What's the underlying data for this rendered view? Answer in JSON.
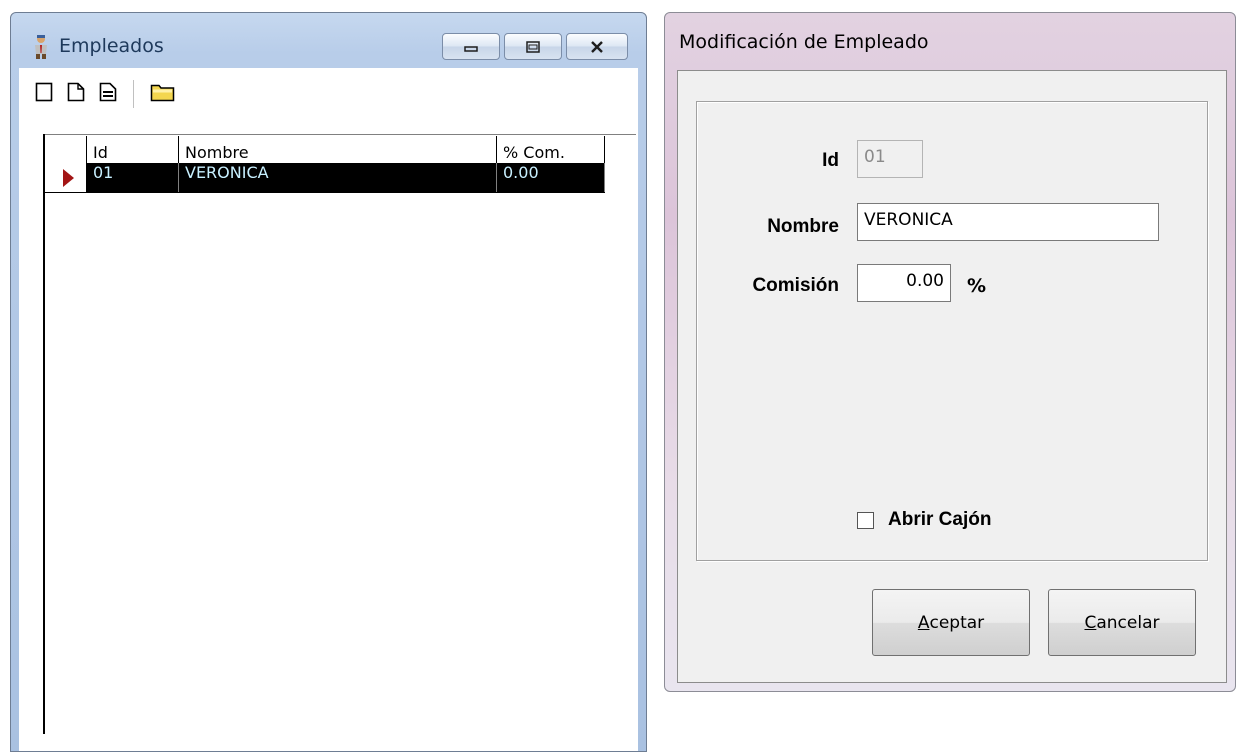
{
  "empleados_window": {
    "title": "Empleados",
    "toolbar": [
      {
        "name": "new-record-icon"
      },
      {
        "name": "new-document-icon"
      },
      {
        "name": "edit-record-icon"
      },
      {
        "name": "open-folder-icon"
      }
    ],
    "grid": {
      "columns": [
        "Id",
        "Nombre",
        "% Com."
      ],
      "rows": [
        {
          "id": "01",
          "nombre": "VERONICA",
          "com": "0.00",
          "selected": true
        }
      ]
    }
  },
  "modificacion_dialog": {
    "title": "Modificación de Empleado",
    "fields": {
      "id_label": "Id",
      "id_value": "01",
      "nombre_label": "Nombre",
      "nombre_value": "VERONICA",
      "comision_label": "Comisión",
      "comision_value": "0.00",
      "comision_unit": "%"
    },
    "abrir_cajon": {
      "label": "Abrir Cajón",
      "checked": false
    },
    "buttons": {
      "aceptar_mnemonic": "A",
      "aceptar_rest": "ceptar",
      "cancelar_mnemonic": "C",
      "cancelar_rest": "ancelar"
    }
  },
  "colors": {
    "grid_selected_bg": "#000000",
    "grid_selected_text": "#c8f0ff",
    "row_indicator": "#a31515",
    "window_frame_blue": "#b8cde9",
    "dialog_frame": "#dcc4d9"
  }
}
